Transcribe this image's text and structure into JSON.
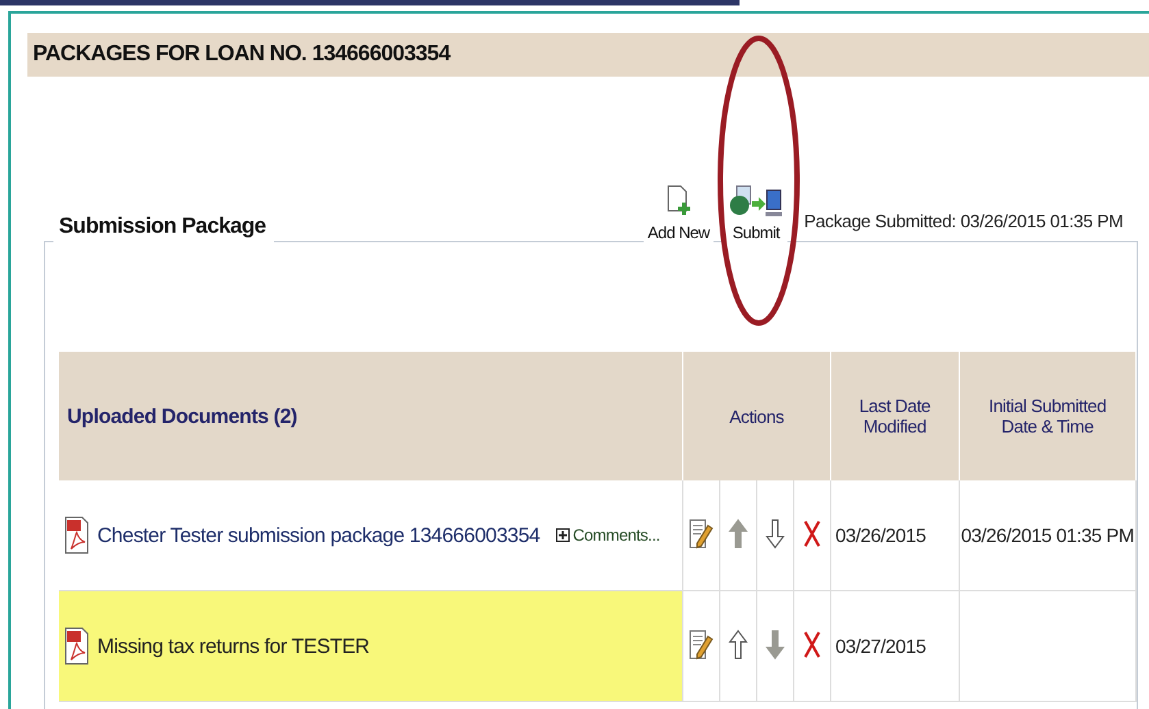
{
  "page_title": "PACKAGES FOR LOAN NO. 134666003354",
  "package": {
    "legend": "Submission Package",
    "toolbar": [
      {
        "kind": "add",
        "label": "Add New",
        "circled": false
      },
      {
        "kind": "submit",
        "label": "Submit",
        "circled": true
      }
    ],
    "status": "Package Submitted: 03/26/2015 01:35 PM"
  },
  "table": {
    "columns": [
      "Uploaded Documents (2)",
      "Actions",
      "Last Date Modified",
      "Initial Submitted Date & Time"
    ],
    "rows": [
      {
        "name": "Chester Tester submission package 134666003354",
        "comments": "Comments...",
        "highlighted": false,
        "up_enabled": false,
        "down_enabled": true,
        "last_modified": "03/26/2015",
        "initial_submitted": "03/26/2015 01:35 PM"
      },
      {
        "name": "Missing tax returns for TESTER",
        "highlighted": true,
        "up_enabled": true,
        "down_enabled": false,
        "last_modified": "03/27/2015"
      }
    ]
  }
}
